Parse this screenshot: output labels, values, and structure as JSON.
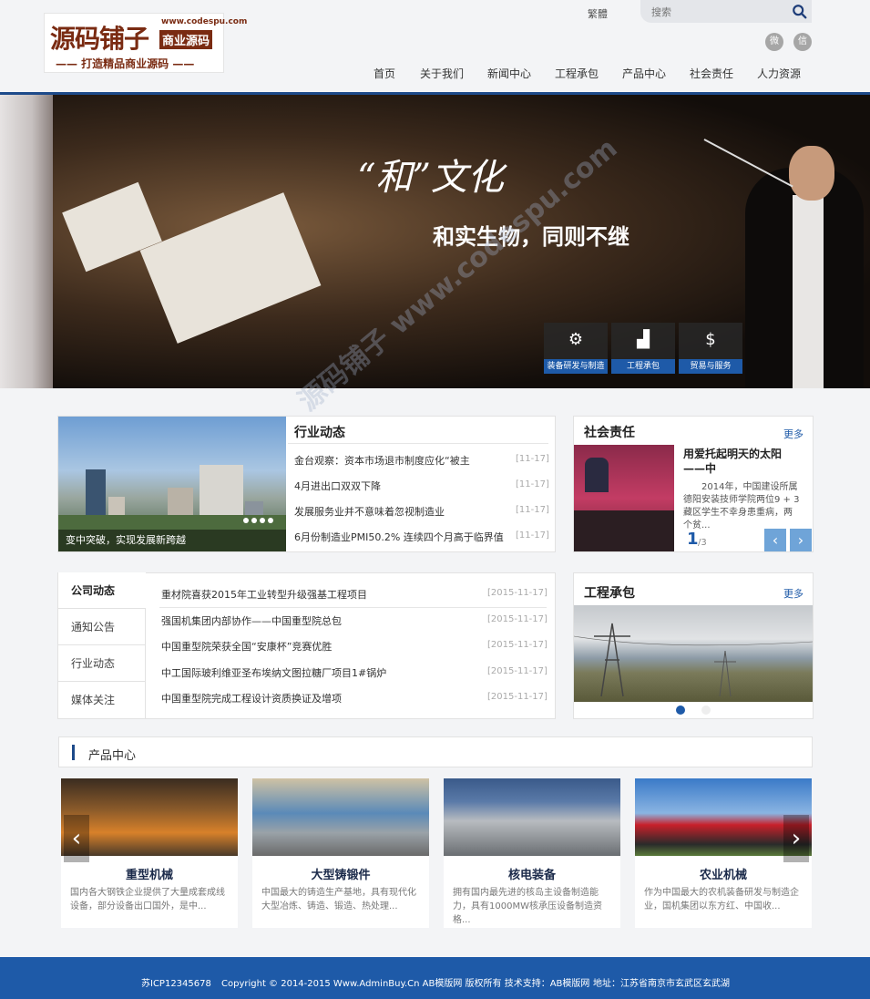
{
  "logo": {
    "main": "源码铺子",
    "url": "www.codespu.com",
    "badge": "商业源码",
    "slogan": "—— 打造精品商业源码 ——"
  },
  "header": {
    "traditional": "繁體",
    "search_placeholder": "搜索"
  },
  "nav": [
    "首页",
    "关于我们",
    "新闻中心",
    "工程承包",
    "产品中心",
    "社会责任",
    "人力资源"
  ],
  "banner": {
    "title": "“和”文化",
    "subtitle": "和实生物，同则不继",
    "tabs": [
      "装备研发与制造",
      "工程承包",
      "贸易与服务"
    ]
  },
  "industry": {
    "title": "行业动态",
    "image_caption": "变中突破，实现发展新跨越",
    "items": [
      {
        "text": "金台观察：资本市场退市制度应化“被主",
        "date": "[11-17]"
      },
      {
        "text": "4月进出口双双下降",
        "date": "[11-17]"
      },
      {
        "text": "发展服务业并不意味着忽视制造业",
        "date": "[11-17]"
      },
      {
        "text": "6月份制造业PMI50.2% 连续四个月高于临界值",
        "date": "[11-17]"
      }
    ]
  },
  "social": {
    "title": "社会责任",
    "more": "更多",
    "headline": "用爱托起明天的太阳——中",
    "body": "2014年，中国建设所属德阳安装技师学院两位9 + 3藏区学生不幸身患重病，两个贫...",
    "page": "1",
    "total": "/3"
  },
  "company": {
    "tabs": [
      "公司动态",
      "通知公告",
      "行业动态",
      "媒体关注"
    ],
    "items": [
      {
        "text": "重材院喜获2015年工业转型升级强基工程项目",
        "date": "[2015-11-17]"
      },
      {
        "text": "强国机集团内部协作——中国重型院总包",
        "date": "[2015-11-17]"
      },
      {
        "text": "中国重型院荣获全国“安康杯”竞赛优胜",
        "date": "[2015-11-17]"
      },
      {
        "text": "中工国际玻利维亚圣布埃纳文图拉糖厂项目1#锅炉",
        "date": "[2015-11-17]"
      },
      {
        "text": "中国重型院完成工程设计资质换证及增项",
        "date": "[2015-11-17]"
      }
    ]
  },
  "project": {
    "title": "工程承包",
    "more": "更多"
  },
  "products": {
    "title": "产品中心",
    "items": [
      {
        "name": "重型机械",
        "desc": "国内各大钢铁企业提供了大量成套成线设备，部分设备出口国外，是中..."
      },
      {
        "name": "大型铸锻件",
        "desc": "中国最大的铸造生产基地，具有现代化大型冶炼、铸造、锻造、热处理..."
      },
      {
        "name": "核电装备",
        "desc": "拥有国内最先进的核岛主设备制造能力，具有1000MW核承压设备制造资格..."
      },
      {
        "name": "农业机械",
        "desc": "作为中国最大的农机装备研发与制造企业，国机集团以东方红、中国收..."
      }
    ]
  },
  "footer": {
    "icp": "苏ICP12345678",
    "copyright": "Copyright © 2014-2015 Www.AdminBuy.Cn AB模版网 版权所有 技术支持：AB模版网",
    "address": "地址：江苏省南京市玄武区玄武湖"
  },
  "watermark": "源码铺子 www.codespu.com"
}
